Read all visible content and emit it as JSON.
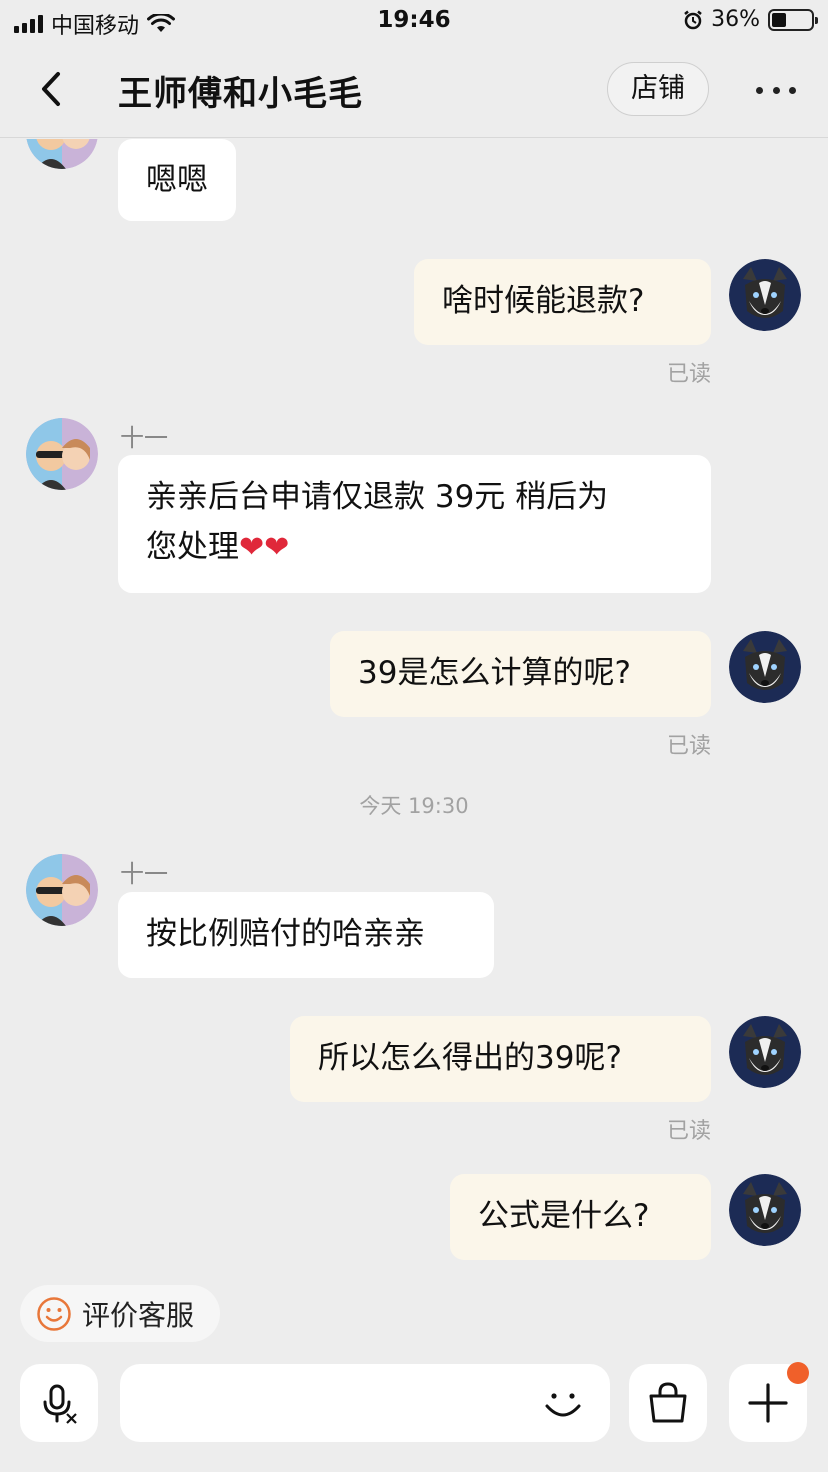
{
  "status_bar": {
    "carrier": "中国移动",
    "time": "19:46",
    "battery": "36%",
    "battery_level": 0.36
  },
  "header": {
    "title": "王师傅和小毛毛",
    "store_label": "店铺"
  },
  "messages": [
    {
      "side": "in",
      "text": "嗯嗯"
    },
    {
      "side": "out",
      "text": "啥时候能退款?",
      "read": "已读"
    },
    {
      "side": "in",
      "sender": "十一",
      "text": "亲亲后台申请仅退款 39元 稍后为",
      "text2": "您处理",
      "hearts": "❤❤"
    },
    {
      "side": "out",
      "text": "39是怎么计算的呢?",
      "read": "已读"
    },
    {
      "side": "time",
      "text": "今天 19:30"
    },
    {
      "side": "in",
      "sender": "十一",
      "text": "按比例赔付的哈亲亲"
    },
    {
      "side": "out",
      "text": "所以怎么得出的39呢?",
      "read": "已读"
    },
    {
      "side": "out",
      "text": "公式是什么?"
    }
  ],
  "bottom": {
    "rate_label": "评价客服",
    "input_placeholder": "",
    "accent": "#f0602a"
  },
  "icons": [
    "back-icon",
    "more-icon",
    "smile-icon",
    "voice-icon",
    "emoji-icon",
    "shopping-bag-icon",
    "plus-icon"
  ]
}
